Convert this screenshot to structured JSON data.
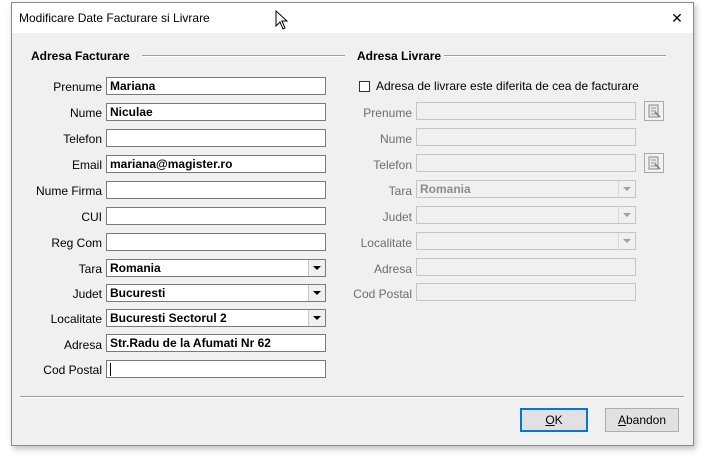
{
  "window": {
    "title": "Modificare Date Facturare si Livrare",
    "close_symbol": "✕"
  },
  "billing": {
    "section_title": "Adresa Facturare",
    "fields": {
      "prenume": {
        "label": "Prenume",
        "value": "Mariana"
      },
      "nume": {
        "label": "Nume",
        "value": "Niculae"
      },
      "telefon": {
        "label": "Telefon",
        "value": ""
      },
      "email": {
        "label": "Email",
        "value": "mariana@magister.ro"
      },
      "nume_firma": {
        "label": "Nume Firma",
        "value": ""
      },
      "cui": {
        "label": "CUI",
        "value": ""
      },
      "reg_com": {
        "label": "Reg Com",
        "value": ""
      },
      "tara": {
        "label": "Tara",
        "value": "Romania"
      },
      "judet": {
        "label": "Judet",
        "value": "Bucuresti"
      },
      "localitate": {
        "label": "Localitate",
        "value": "Bucuresti Sectorul 2"
      },
      "adresa": {
        "label": "Adresa",
        "value": "Str.Radu de la Afumati Nr 62"
      },
      "cod_postal": {
        "label": "Cod Postal",
        "value": ""
      }
    }
  },
  "shipping": {
    "section_title": "Adresa Livrare",
    "different_checkbox": {
      "label": "Adresa de livrare este diferita de cea de facturare",
      "checked": false
    },
    "fields": {
      "prenume": {
        "label": "Prenume",
        "value": ""
      },
      "nume": {
        "label": "Nume",
        "value": ""
      },
      "telefon": {
        "label": "Telefon",
        "value": ""
      },
      "tara": {
        "label": "Tara",
        "value": "Romania"
      },
      "judet": {
        "label": "Judet",
        "value": ""
      },
      "localitate": {
        "label": "Localitate",
        "value": ""
      },
      "adresa": {
        "label": "Adresa",
        "value": ""
      },
      "cod_postal": {
        "label": "Cod Postal",
        "value": ""
      }
    }
  },
  "buttons": {
    "ok": {
      "accel": "O",
      "rest": "K"
    },
    "abandon": {
      "accel": "A",
      "rest": "bandon"
    }
  },
  "icons": {
    "contact_picker": "address-book-icon",
    "dropdown": "chevron-down-icon"
  }
}
